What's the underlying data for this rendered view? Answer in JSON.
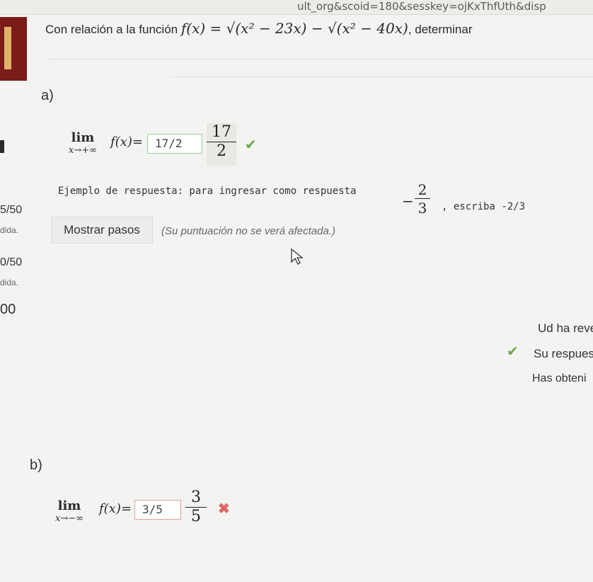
{
  "browser": {
    "url_fragment": "ult_org&scoid=180&sesskey=ojKxThfUth&disp"
  },
  "sidebar": {
    "texts": [
      "5/50",
      "dida.",
      "0/50",
      "dida.",
      "00"
    ]
  },
  "question": {
    "prompt_prefix": "Con relación a la función",
    "function": "f(x) = √(x² − 23x) − √(x² − 40x)",
    "prompt_suffix": ", determinar",
    "fx_label": "f(x)="
  },
  "part_a": {
    "label": "a)",
    "lim": "lim",
    "subscript": "x→+∞",
    "answer_value": "17/2",
    "preview_num": "17",
    "preview_den": "2",
    "status": "correct"
  },
  "example": {
    "text": "Ejemplo de respuesta: para ingresar como respuesta",
    "frac_sign": "−",
    "frac_num": "2",
    "frac_den": "3",
    "tail": ", escriba -2/3"
  },
  "steps": {
    "button_label": "Mostrar pasos",
    "note": "(Su puntuación no se verá afectada.)"
  },
  "feedback": {
    "line1": "Ud ha reve",
    "line2": "Su respues",
    "line3": "Has obteni"
  },
  "part_b": {
    "label": "b)",
    "lim": "lim",
    "subscript": "x→−∞",
    "answer_value": "3/5",
    "preview_num": "3",
    "preview_den": "5",
    "status": "incorrect"
  },
  "colors": {
    "correct": "#6aa84f",
    "incorrect": "#e06666",
    "sidebar_accent": "#7b1c1a"
  }
}
